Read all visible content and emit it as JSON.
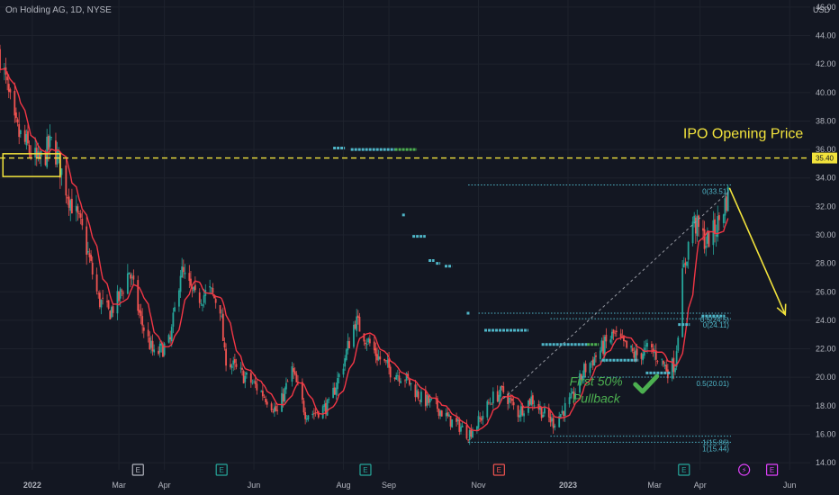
{
  "header": {
    "symbol_line": "On Holding AG, 1D, NYSE",
    "currency": "USD"
  },
  "colors": {
    "background": "#131722",
    "grid": "#1e222d",
    "axis_text": "#b2b5be",
    "up": "#26a69a",
    "down": "#ef5350",
    "ma": "#f23645",
    "ipo_line": "#f2e33c",
    "fib": "#4fb6c8",
    "fib_text": "#4caf50",
    "signal": "#4fb6c8",
    "signal_alt": "#4caf50"
  },
  "chart_data": {
    "type": "candlestick",
    "y_axis": {
      "min": 13.5,
      "max": 46.5,
      "ticks": [
        14.0,
        16.0,
        18.0,
        20.0,
        22.0,
        24.0,
        26.0,
        28.0,
        30.0,
        32.0,
        34.0,
        36.0,
        38.0,
        40.0,
        42.0,
        44.0,
        46.0
      ],
      "tick_labels": [
        "14.00",
        "16.00",
        "18.00",
        "20.00",
        "22.00",
        "24.00",
        "26.00",
        "28.00",
        "30.00",
        "32.00",
        "34.00",
        "36.00",
        "38.00",
        "40.00",
        "42.00",
        "44.00",
        "46.00"
      ]
    },
    "x_axis": {
      "start": "2021-12-10",
      "end": "2023-06-15",
      "labels": [
        {
          "label": "2022",
          "date": "2022-01-01",
          "bold": true
        },
        {
          "label": "Mar",
          "date": "2022-03-01"
        },
        {
          "label": "Apr",
          "date": "2022-04-01"
        },
        {
          "label": "Jun",
          "date": "2022-06-01"
        },
        {
          "label": "Aug",
          "date": "2022-08-01"
        },
        {
          "label": "Sep",
          "date": "2022-09-01"
        },
        {
          "label": "Nov",
          "date": "2022-11-01"
        },
        {
          "label": "2023",
          "date": "2023-01-01",
          "bold": true
        },
        {
          "label": "Mar",
          "date": "2023-03-01"
        },
        {
          "label": "Apr",
          "date": "2023-04-01"
        },
        {
          "label": "Jun",
          "date": "2023-06-01"
        }
      ]
    },
    "price_path": [
      [
        "2021-12-10",
        42.8
      ],
      [
        "2021-12-20",
        37.5
      ],
      [
        "2022-01-05",
        35.0
      ],
      [
        "2022-01-15",
        36.5
      ],
      [
        "2022-01-25",
        33.0
      ],
      [
        "2022-02-05",
        30.0
      ],
      [
        "2022-02-15",
        25.5
      ],
      [
        "2022-02-22",
        24.5
      ],
      [
        "2022-03-01",
        25.5
      ],
      [
        "2022-03-08",
        27.5
      ],
      [
        "2022-03-16",
        24.0
      ],
      [
        "2022-03-25",
        21.5
      ],
      [
        "2022-04-05",
        22.5
      ],
      [
        "2022-04-12",
        27.5
      ],
      [
        "2022-04-22",
        25.5
      ],
      [
        "2022-05-02",
        26.0
      ],
      [
        "2022-05-09",
        25.0
      ],
      [
        "2022-05-12",
        21.5
      ],
      [
        "2022-05-20",
        20.5
      ],
      [
        "2022-06-01",
        19.5
      ],
      [
        "2022-06-10",
        18.5
      ],
      [
        "2022-06-17",
        17.5
      ],
      [
        "2022-06-27",
        20.5
      ],
      [
        "2022-07-06",
        17.5
      ],
      [
        "2022-07-12",
        17.5
      ],
      [
        "2022-07-22",
        18.0
      ],
      [
        "2022-08-01",
        21.0
      ],
      [
        "2022-08-09",
        24.0
      ],
      [
        "2022-08-15",
        23.0
      ],
      [
        "2022-08-24",
        21.5
      ],
      [
        "2022-09-02",
        20.5
      ],
      [
        "2022-09-12",
        20.0
      ],
      [
        "2022-09-23",
        18.5
      ],
      [
        "2022-10-03",
        18.0
      ],
      [
        "2022-10-12",
        17.0
      ],
      [
        "2022-10-20",
        16.5
      ],
      [
        "2022-10-25",
        16.0
      ],
      [
        "2022-11-02",
        17.0
      ],
      [
        "2022-11-10",
        18.5
      ],
      [
        "2022-11-18",
        19.0
      ],
      [
        "2022-11-28",
        17.5
      ],
      [
        "2022-12-07",
        18.5
      ],
      [
        "2022-12-15",
        17.5
      ],
      [
        "2022-12-22",
        16.8
      ],
      [
        "2023-01-04",
        18.5
      ],
      [
        "2023-01-12",
        20.5
      ],
      [
        "2023-01-20",
        21.5
      ],
      [
        "2023-02-01",
        23.0
      ],
      [
        "2023-02-10",
        22.0
      ],
      [
        "2023-02-16",
        21.5
      ],
      [
        "2023-02-25",
        22.0
      ],
      [
        "2023-03-03",
        21.5
      ],
      [
        "2023-03-10",
        20.5
      ],
      [
        "2023-03-15",
        21.0
      ],
      [
        "2023-03-20",
        27.0
      ],
      [
        "2023-03-27",
        31.0
      ],
      [
        "2023-04-05",
        29.5
      ],
      [
        "2023-04-12",
        30.5
      ],
      [
        "2023-04-20",
        32.8
      ]
    ],
    "horizontal_lines": [
      {
        "name": "IPO Opening Price",
        "price": 35.4,
        "style": "dashed"
      }
    ],
    "price_tag": {
      "value": 35.4,
      "label": "35.40"
    },
    "fib_levels": [
      {
        "label": "0(33.51)",
        "price": 33.51,
        "start": "2022-10-25",
        "end": "2023-04-22"
      },
      {
        "label": "0.5(20.01)",
        "price": 20.01,
        "start": "2023-01-08",
        "end": "2023-04-22"
      },
      {
        "label": "1(15.44)",
        "price": 15.44,
        "start": "2022-10-25",
        "end": "2023-04-22"
      },
      {
        "label": "1(15.86)",
        "price": 15.86,
        "start": "2022-12-20",
        "end": "2023-04-22"
      },
      {
        "label": "0(24.11)",
        "price": 24.11,
        "start": "2022-12-20",
        "end": "2023-04-22"
      },
      {
        "label": "0.5(24.5)",
        "price": 24.5,
        "start": "2022-11-01",
        "end": "2023-04-22"
      }
    ],
    "signal_bars": [
      {
        "start": "2022-07-25",
        "end": "2022-08-02",
        "price": 36.1,
        "color": "signal"
      },
      {
        "start": "2022-08-06",
        "end": "2022-09-05",
        "price": 36.0,
        "color": "signal"
      },
      {
        "start": "2022-09-05",
        "end": "2022-09-20",
        "price": 36.0,
        "color": "signal_alt"
      },
      {
        "start": "2022-09-10",
        "end": "2022-09-12",
        "price": 31.4,
        "color": "signal"
      },
      {
        "start": "2022-09-17",
        "end": "2022-09-26",
        "price": 29.9,
        "color": "signal"
      },
      {
        "start": "2022-09-28",
        "end": "2022-10-02",
        "price": 28.2,
        "color": "signal"
      },
      {
        "start": "2022-10-03",
        "end": "2022-10-06",
        "price": 28.0,
        "color": "signal"
      },
      {
        "start": "2022-10-09",
        "end": "2022-10-14",
        "price": 27.8,
        "color": "signal"
      },
      {
        "start": "2022-10-24",
        "end": "2022-10-26",
        "price": 24.5,
        "color": "signal"
      },
      {
        "start": "2022-11-05",
        "end": "2022-12-05",
        "price": 23.3,
        "color": "signal"
      },
      {
        "start": "2022-12-14",
        "end": "2023-01-14",
        "price": 22.3,
        "color": "signal"
      },
      {
        "start": "2023-01-14",
        "end": "2023-01-22",
        "price": 22.3,
        "color": "signal_alt"
      },
      {
        "start": "2023-01-24",
        "end": "2023-02-18",
        "price": 21.2,
        "color": "signal"
      },
      {
        "start": "2023-02-23",
        "end": "2023-03-12",
        "price": 20.3,
        "color": "signal"
      },
      {
        "start": "2023-03-17",
        "end": "2023-03-25",
        "price": 23.7,
        "color": "signal"
      },
      {
        "start": "2023-04-02",
        "end": "2023-04-18",
        "price": 24.3,
        "color": "signal"
      }
    ],
    "projection_arrow": {
      "from": [
        "2023-04-21",
        33.3
      ],
      "to": [
        "2023-05-29",
        24.4
      ]
    },
    "diagonal": {
      "from": [
        "2022-11-18",
        18.5
      ],
      "to": [
        "2023-04-20",
        33.0
      ]
    },
    "highlight_box": {
      "from": [
        "2021-12-12",
        35.7
      ],
      "to": [
        "2022-01-20",
        34.1
      ]
    },
    "annotations": [
      {
        "text": "IPO Opening Price",
        "date": "2023-05-29",
        "price": 36.8,
        "color": "ipo_line",
        "size": 16
      },
      {
        "text": "First 50%",
        "date": "2023-01-02",
        "price": 19.4,
        "color": "fib_text",
        "size": 14,
        "italic": true
      },
      {
        "text": "Pullback",
        "date": "2023-01-04",
        "price": 18.2,
        "color": "fib_text",
        "size": 14,
        "italic": true
      }
    ],
    "events": [
      {
        "label": "E",
        "date": "2022-03-14",
        "color": "#b2b5be"
      },
      {
        "label": "E",
        "date": "2022-05-10",
        "color": "#26a69a"
      },
      {
        "label": "E",
        "date": "2022-08-16",
        "color": "#26a69a"
      },
      {
        "label": "E",
        "date": "2022-11-15",
        "color": "#ef5350"
      },
      {
        "label": "E",
        "date": "2023-03-21",
        "color": "#26a69a"
      },
      {
        "label": "⚡",
        "date": "2023-05-01",
        "color": "#e040fb",
        "round": true
      },
      {
        "label": "E",
        "date": "2023-05-20",
        "color": "#e040fb"
      }
    ]
  }
}
